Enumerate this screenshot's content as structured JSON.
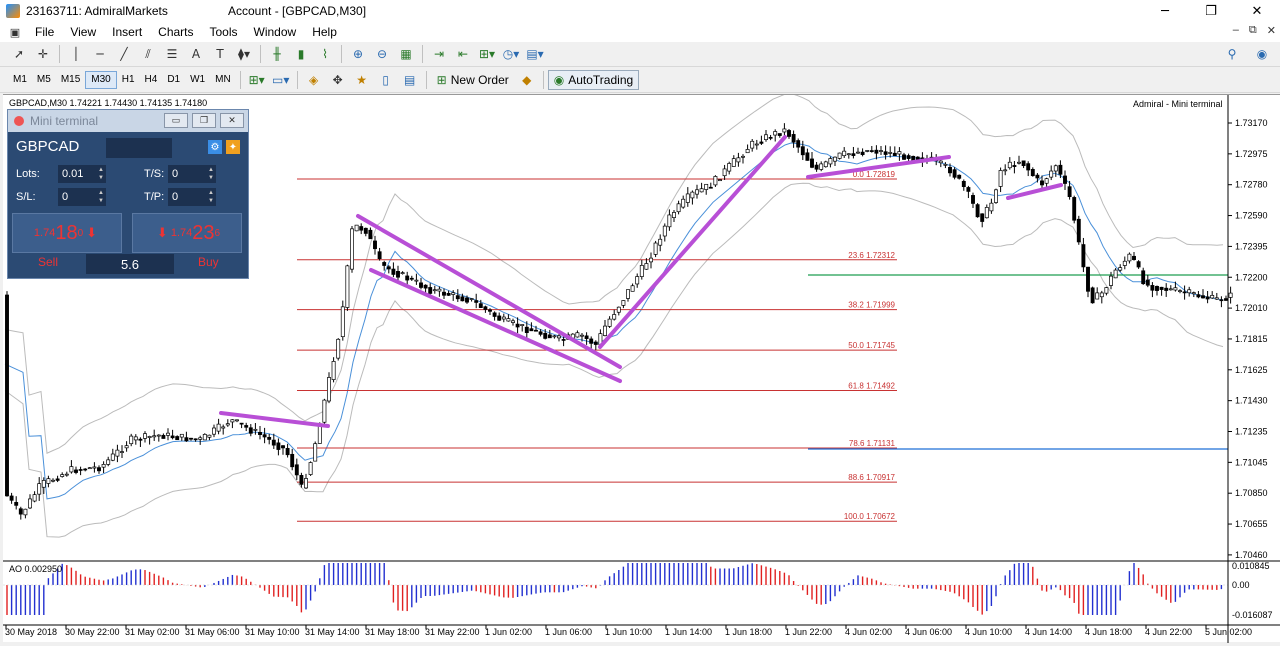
{
  "window": {
    "title_left": "23163711: AdmiralMarkets",
    "title_center": "Account - [GBPCAD,M30]",
    "min": "─",
    "max": "❐",
    "close": "✕"
  },
  "menu": {
    "items": [
      "File",
      "View",
      "Insert",
      "Charts",
      "Tools",
      "Window",
      "Help"
    ],
    "mdi": [
      "–",
      "⧉",
      "✕"
    ]
  },
  "toolbar": {
    "timeframes": [
      "M1",
      "M5",
      "M15",
      "M30",
      "H1",
      "H4",
      "D1",
      "W1",
      "MN"
    ],
    "active_timeframe": "M30",
    "new_order_label": "New Order",
    "autotrading_label": "AutoTrading"
  },
  "chart": {
    "info_line": "GBPCAD,M30  1.74221 1.74430 1.74135 1.74180",
    "indicator_label": "Admiral - Mini terminal",
    "ao_label": "AO 0.002950",
    "price_ticks": [
      "1.73170",
      "1.72975",
      "1.72780",
      "1.72590",
      "1.72395",
      "1.72200",
      "1.72010",
      "1.71815",
      "1.71625",
      "1.71430",
      "1.71235",
      "1.71045",
      "1.70850",
      "1.70655",
      "1.70460"
    ],
    "ao_ticks": [
      "0.010845",
      "0.00",
      "-0.016087"
    ],
    "time_ticks": [
      "30 May 2018",
      "30 May 22:00",
      "31 May 02:00",
      "31 May 06:00",
      "31 May 10:00",
      "31 May 14:00",
      "31 May 18:00",
      "31 May 22:00",
      "1 Jun 02:00",
      "1 Jun 06:00",
      "1 Jun 10:00",
      "1 Jun 14:00",
      "1 Jun 18:00",
      "1 Jun 22:00",
      "4 Jun 02:00",
      "4 Jun 06:00",
      "4 Jun 10:00",
      "4 Jun 14:00",
      "4 Jun 18:00",
      "4 Jun 22:00",
      "5 Jun 02:00"
    ],
    "fib_labels": [
      "0.0 1.72819",
      "23.6 1.72312",
      "38.2 1.71999",
      "50.0 1.71745",
      "61.8 1.71492",
      "78.6 1.71131",
      "88.6 1.70917",
      "100.0 1.70672"
    ],
    "colors": {
      "fib": "#c83232",
      "trend": "#b84fd6",
      "bull": "#000000",
      "bear": "#000000",
      "ma": "#4a90d9",
      "band": "#bbbbbb",
      "hline_green": "#1e9e50",
      "hline_blue": "#1e6fd6",
      "ao_up": "#2230d0",
      "ao_down": "#e02020"
    }
  },
  "mini_terminal": {
    "title": "Mini terminal",
    "symbol": "GBPCAD",
    "lots_label": "Lots:",
    "lots_value": "0.01",
    "sl_label": "S/L:",
    "sl_value": "0",
    "ts_label": "T/S:",
    "ts_value": "0",
    "tp_label": "T/P:",
    "tp_value": "0",
    "sell_prefix": "1.74",
    "sell_big": "18",
    "sell_sup": "0",
    "buy_prefix": "1.74",
    "buy_big": "23",
    "buy_sup": "6",
    "sell_label": "Sell",
    "buy_label": "Buy",
    "volume": "5.6"
  }
}
